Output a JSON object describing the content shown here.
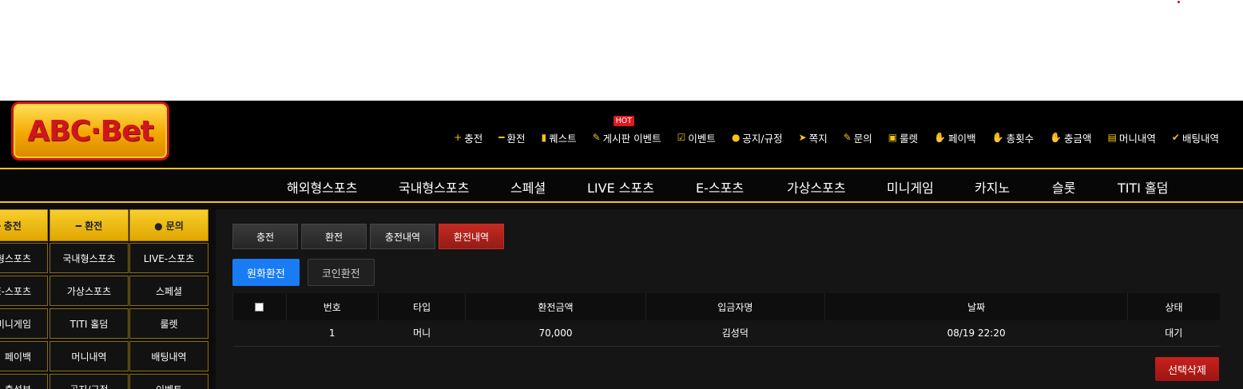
{
  "logo": {
    "text": "ABC·Bet"
  },
  "topnav": [
    {
      "icon": "plus-icon",
      "glyph": "+",
      "label": "충전"
    },
    {
      "icon": "minus-icon",
      "glyph": "━",
      "label": "환전"
    },
    {
      "icon": "scroll-icon",
      "glyph": "▮",
      "label": "퀘스트"
    },
    {
      "icon": "board-icon",
      "glyph": "✎",
      "label": "게시판 이벤트",
      "badge": "HOT"
    },
    {
      "icon": "calendar-check-icon",
      "glyph": "☑",
      "label": "이벤트"
    },
    {
      "icon": "exclamation-circle-icon",
      "glyph": "●",
      "label": "공지/규정"
    },
    {
      "icon": "paper-plane-icon",
      "glyph": "➤",
      "label": "쪽지"
    },
    {
      "icon": "edit-icon",
      "glyph": "✎",
      "label": "문의"
    },
    {
      "icon": "gift-icon",
      "glyph": "▣",
      "label": "룰렛"
    },
    {
      "icon": "hand-coin-icon",
      "glyph": "✋",
      "label": "페이백"
    },
    {
      "icon": "hand-coin-icon",
      "glyph": "✋",
      "label": "총횟수"
    },
    {
      "icon": "hand-coin-icon",
      "glyph": "✋",
      "label": "충금액"
    },
    {
      "icon": "receipt-icon",
      "glyph": "▤",
      "label": "머니내역"
    },
    {
      "icon": "check-icon",
      "glyph": "✔",
      "label": "배팅내역"
    }
  ],
  "mainnav": [
    "해외형스포츠",
    "국내형스포츠",
    "스페셜",
    "LIVE 스포츠",
    "E-스포츠",
    "가상스포츠",
    "미니게임",
    "카지노",
    "슬롯",
    "TITI 홀덤"
  ],
  "sidebar": {
    "top": [
      "━ 충전",
      "━ 환전",
      "● 문의"
    ],
    "rows": [
      [
        "해외형스포츠",
        "국내형스포츠",
        "LIVE-스포츠"
      ],
      [
        "E-스포츠",
        "가상스포츠",
        "스페셜"
      ],
      [
        "미니게임",
        "TITI 홀덤",
        "룰렛"
      ],
      [
        "페이백",
        "머니내역",
        "배팅내역"
      ],
      [
        "출석부",
        "공지/규정",
        "이벤트"
      ]
    ]
  },
  "tabs": [
    "충전",
    "환전",
    "충전내역",
    "환전내역"
  ],
  "subtabs": [
    "원화환전",
    "코인환전"
  ],
  "table": {
    "headers": [
      "번호",
      "타입",
      "환전금액",
      "입금자명",
      "날짜",
      "상태"
    ],
    "rows": [
      [
        "1",
        "머니",
        "70,000",
        "김성덕",
        "08/19 22:20",
        "대기"
      ]
    ]
  },
  "delete_button": "선택삭제",
  "colors": {
    "accent_gold": "#f5c518",
    "active_tab_red": "#b3221b",
    "active_subtab_blue": "#1a7cf5"
  }
}
